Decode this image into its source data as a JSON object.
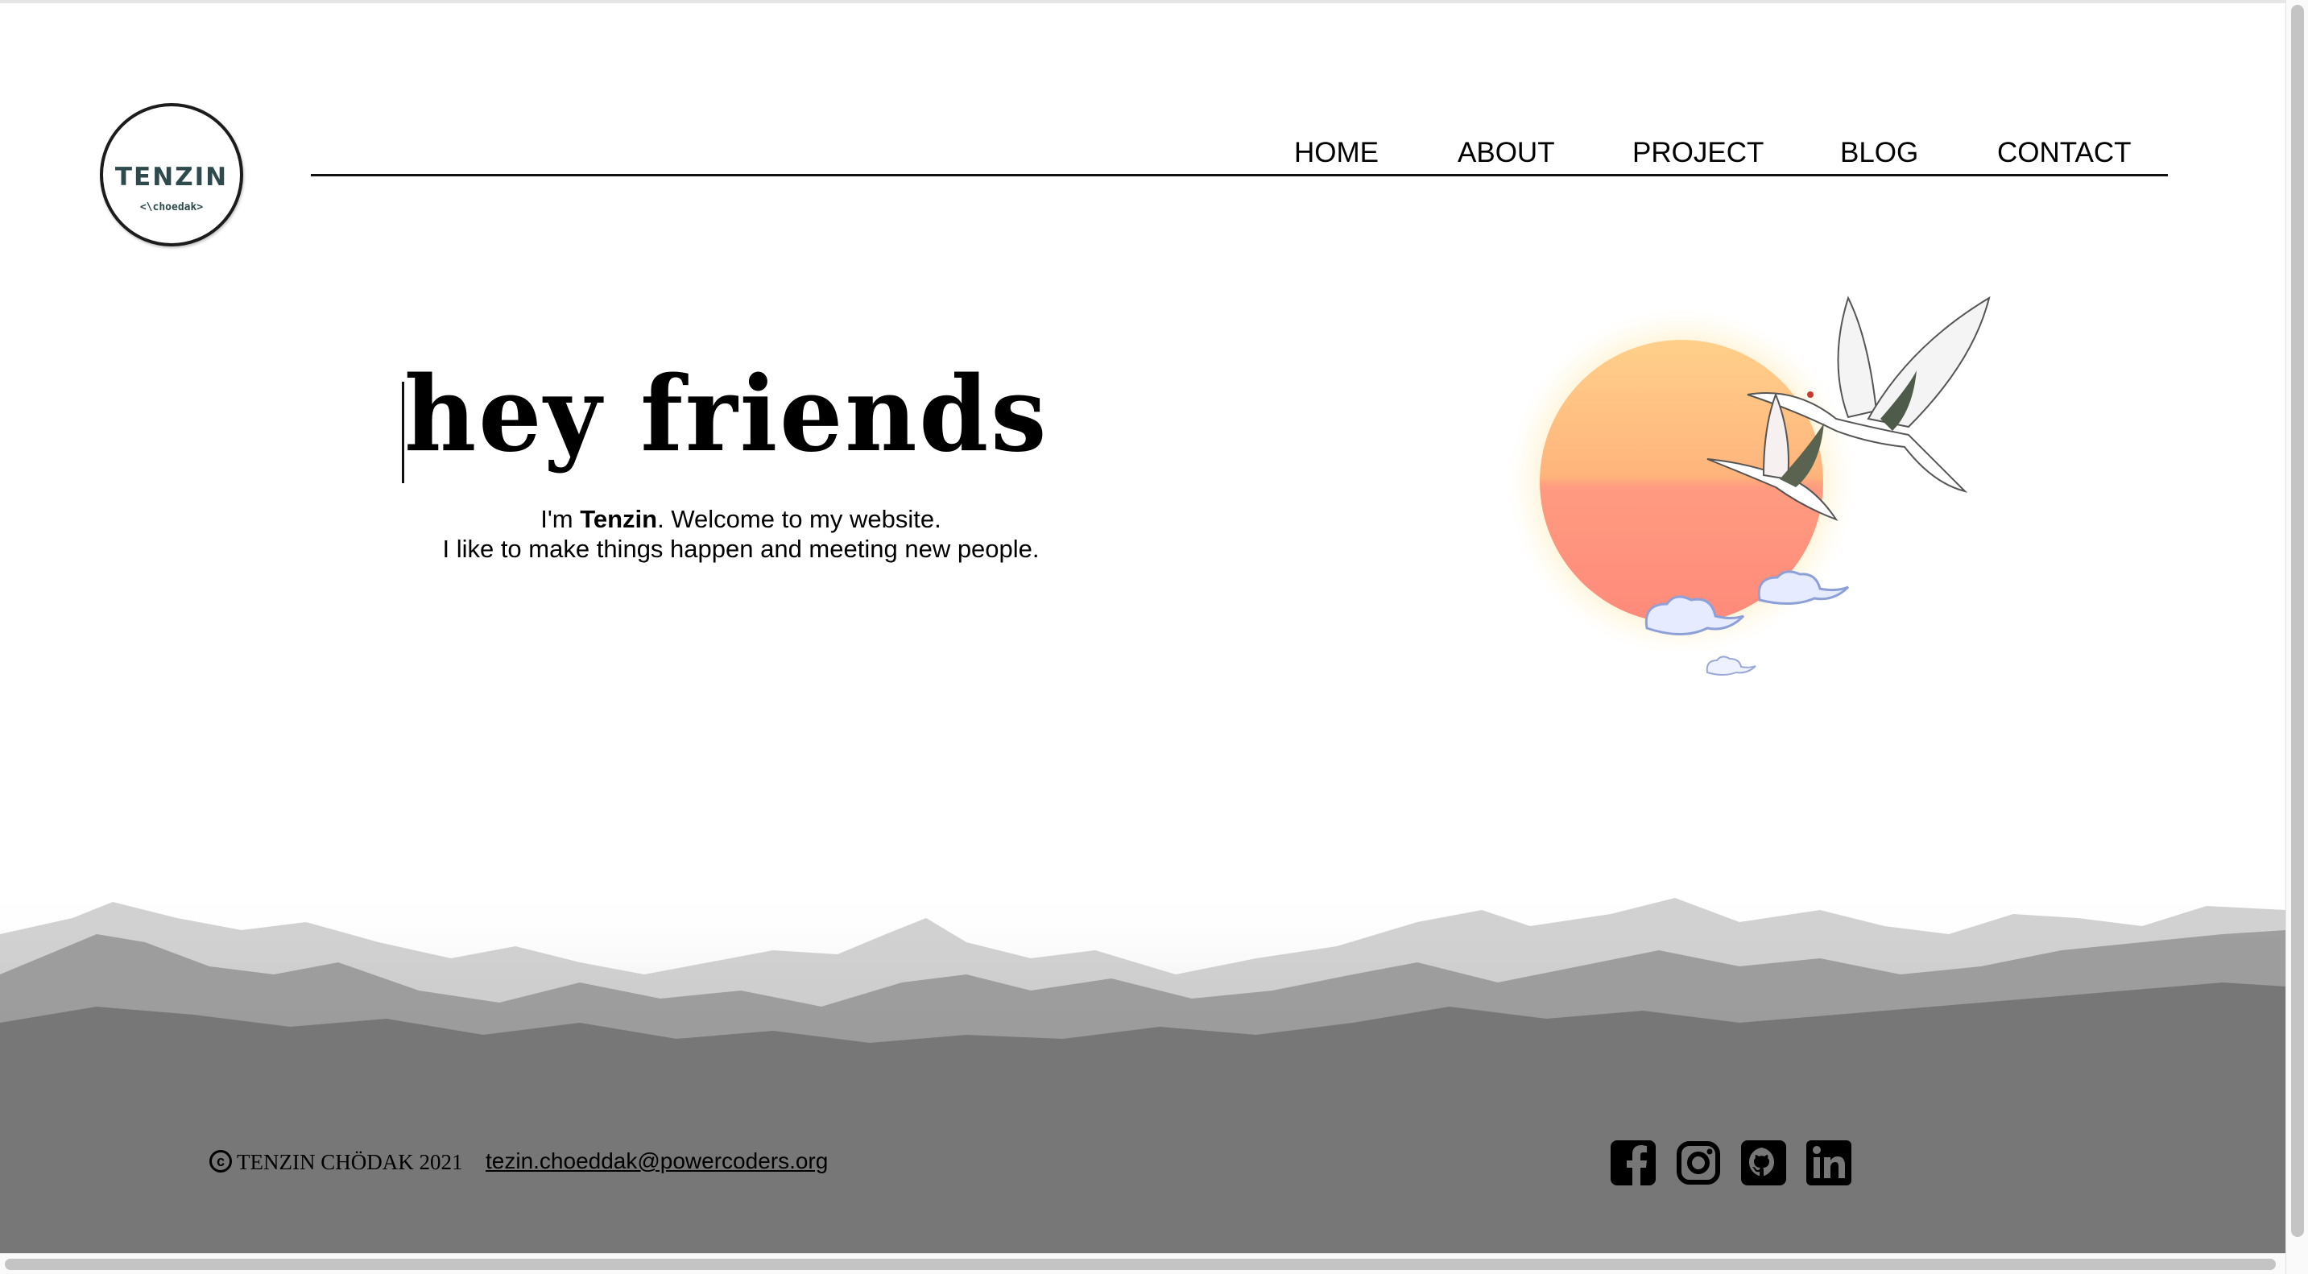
{
  "logo": {
    "name": "TENZIN",
    "sub": "<\\choedak>"
  },
  "nav": [
    {
      "label": "HOME"
    },
    {
      "label": "ABOUT"
    },
    {
      "label": "PROJECT"
    },
    {
      "label": "BLOG"
    },
    {
      "label": "CONTACT"
    }
  ],
  "hero": {
    "title": "hey friends",
    "line1_prefix": "I'm ",
    "line1_name": "Tenzin",
    "line1_suffix": ". Welcome to my website.",
    "line2": "I like to make things happen and meeting new people."
  },
  "footer": {
    "copyright": "TENZIN CHÖDAK 2021",
    "email": "tezin.choeddak@powercoders.org",
    "social_icons": [
      "facebook-icon",
      "instagram-icon",
      "github-icon",
      "linkedin-icon"
    ]
  },
  "colors": {
    "footer": "#777777",
    "sun_top": "#ffd08a",
    "sun_bottom": "#ff8a7a",
    "logo_text": "#2e4a4d"
  }
}
